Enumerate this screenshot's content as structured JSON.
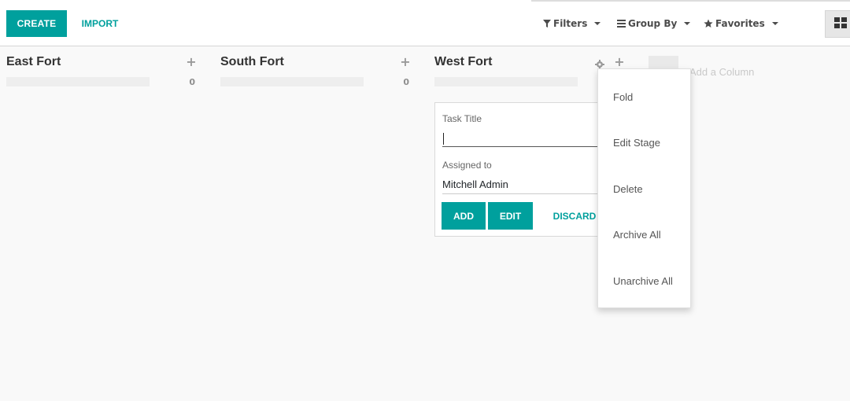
{
  "toolbar": {
    "create_label": "CREATE",
    "import_label": "IMPORT"
  },
  "search": {
    "filters_label": "Filters",
    "group_by_label": "Group By",
    "favorites_label": "Favorites"
  },
  "columns": [
    {
      "title": "East Fort",
      "count": "0"
    },
    {
      "title": "South Fort",
      "count": "0"
    },
    {
      "title": "West Fort",
      "count": ""
    }
  ],
  "add_column_label": "Add a Column",
  "quick_create": {
    "task_title_label": "Task Title",
    "task_title_value": "",
    "assigned_label": "Assigned to",
    "assigned_value": "Mitchell Admin",
    "add_label": "ADD",
    "edit_label": "EDIT",
    "discard_label": "DISCARD"
  },
  "column_menu": {
    "items": [
      "Fold",
      "Edit Stage",
      "Delete",
      "Archive All",
      "Unarchive All"
    ]
  },
  "colors": {
    "accent": "#00a09d",
    "background": "#f9f9f9"
  }
}
